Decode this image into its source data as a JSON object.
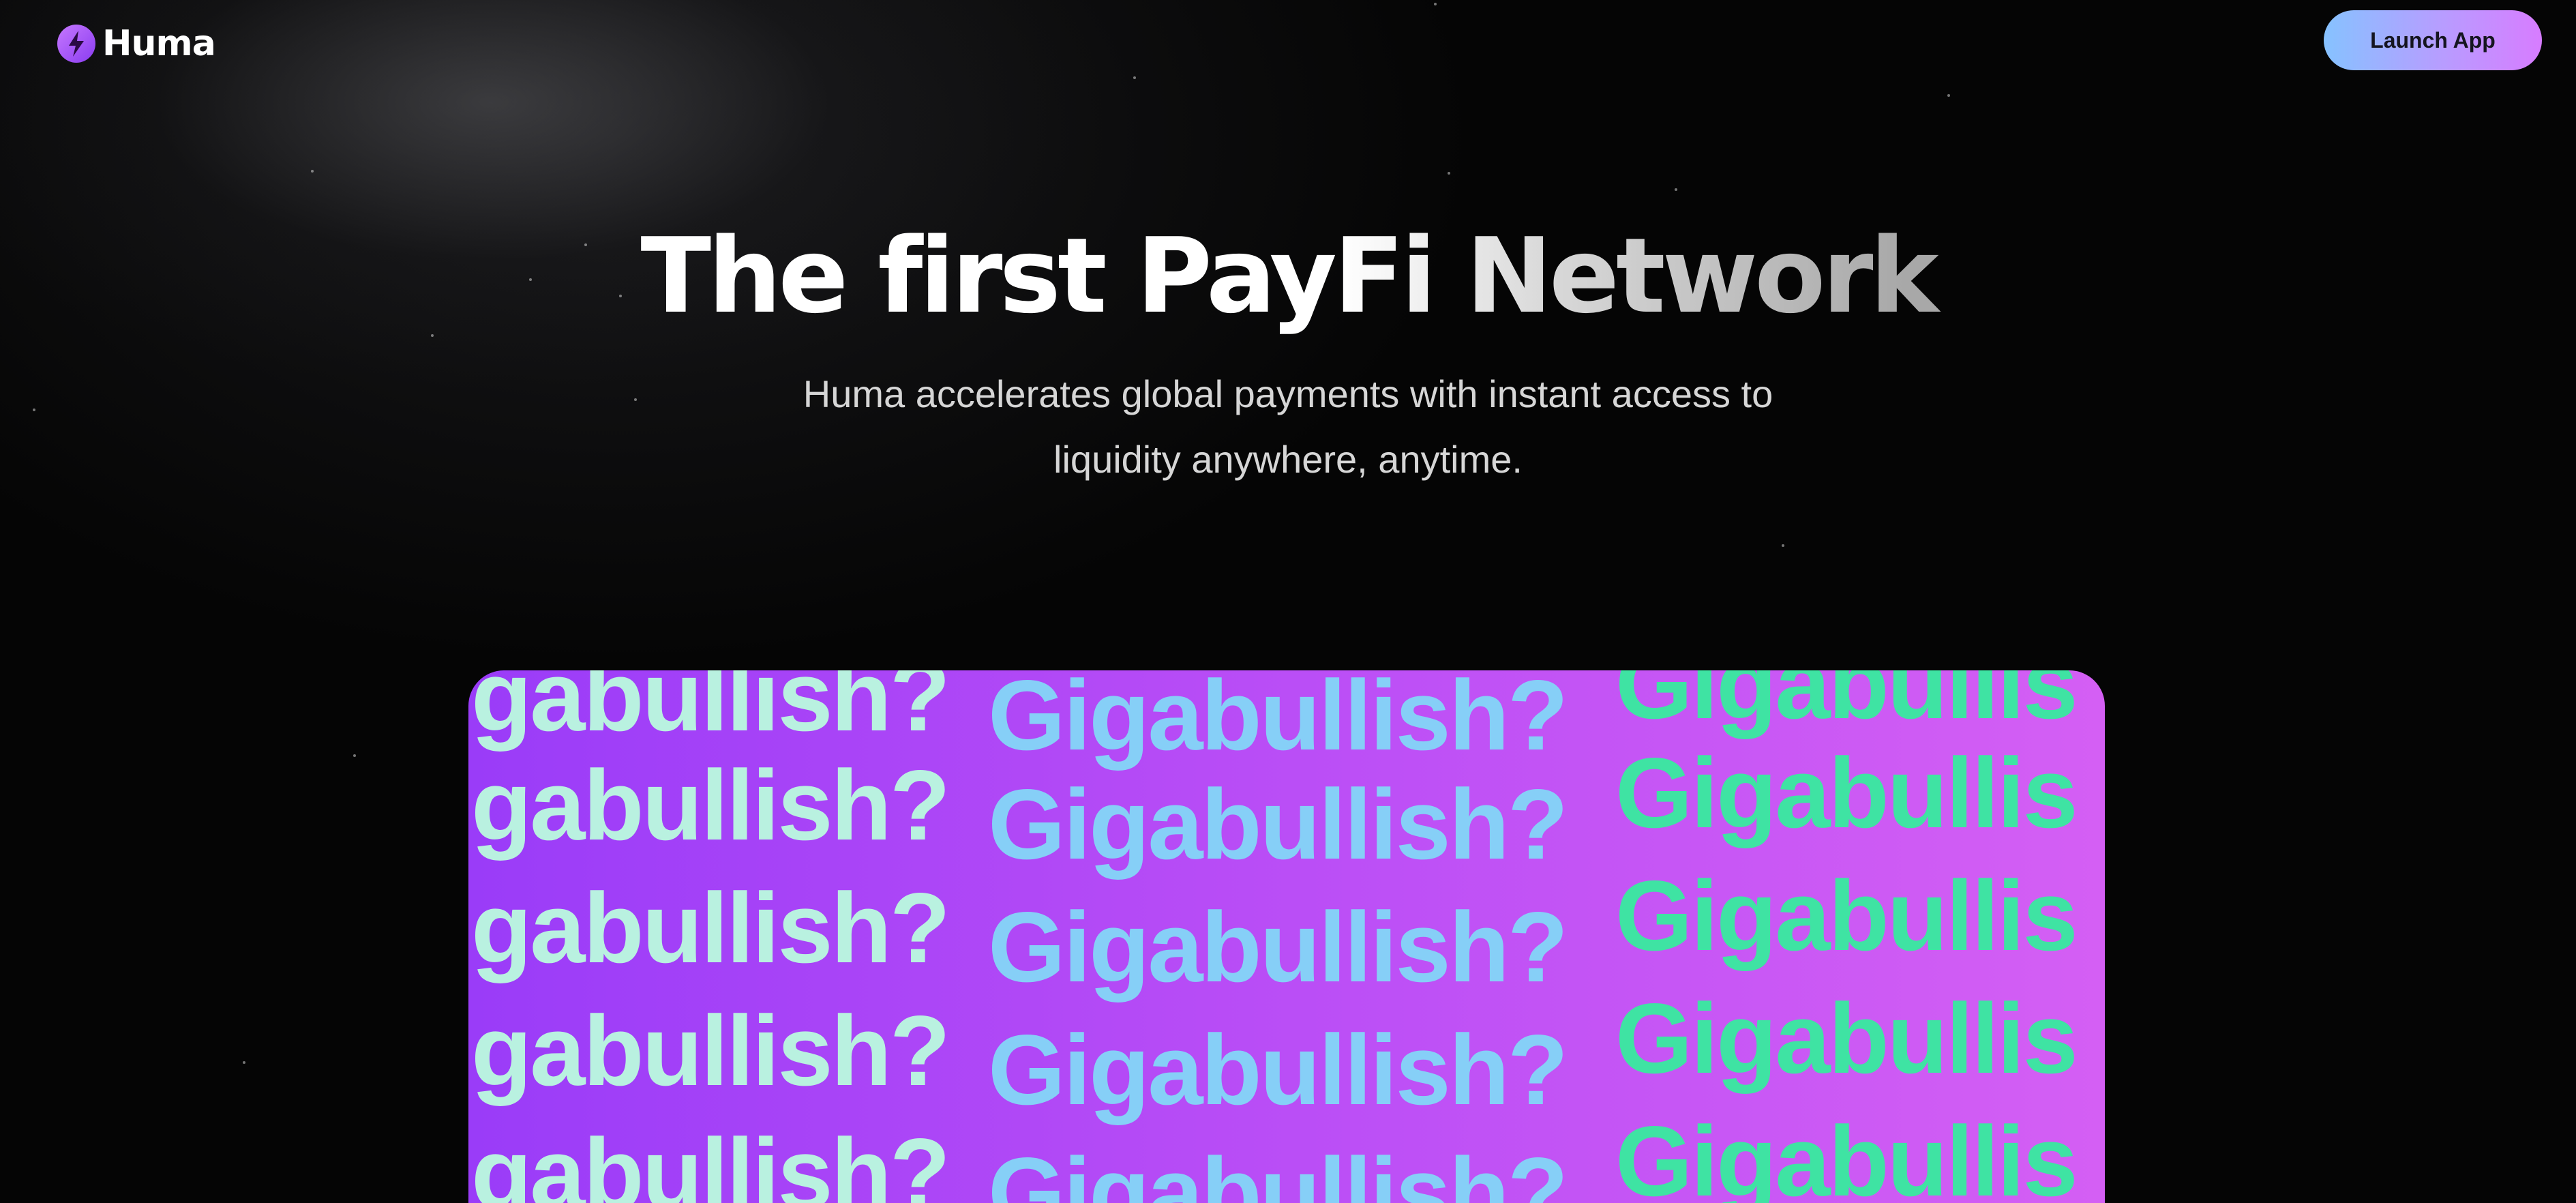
{
  "header": {
    "logo_text": "Huma",
    "logo_icon": "lightning-bolt-icon",
    "launch_button_label": "Launch App"
  },
  "hero": {
    "title": "The first PayFi Network",
    "subtitle_line1": "Huma accelerates global payments with instant access to",
    "subtitle_line2": "liquidity anywhere, anytime."
  },
  "banner": {
    "column1": [
      "gabullish?",
      "gabullish?",
      "gabullish?",
      "gabullish?",
      "gabullish?"
    ],
    "column2": [
      "Gigabullish?",
      "Gigabullish?",
      "Gigabullish?",
      "Gigabullish?",
      "Gigabullish?"
    ],
    "column3": [
      "Gigabullis",
      "Gigabullis",
      "Gigabullis",
      "Gigabullis",
      "Gigabullis"
    ]
  },
  "colors": {
    "background": "#050505",
    "accent_purple": "#a24cf5",
    "button_gradient_start": "#86c2ff",
    "button_gradient_end": "#d77cff",
    "banner_text_mint": "#b9f1e0",
    "banner_text_blue": "#86cff7",
    "banner_text_green": "#3fe3a3"
  }
}
